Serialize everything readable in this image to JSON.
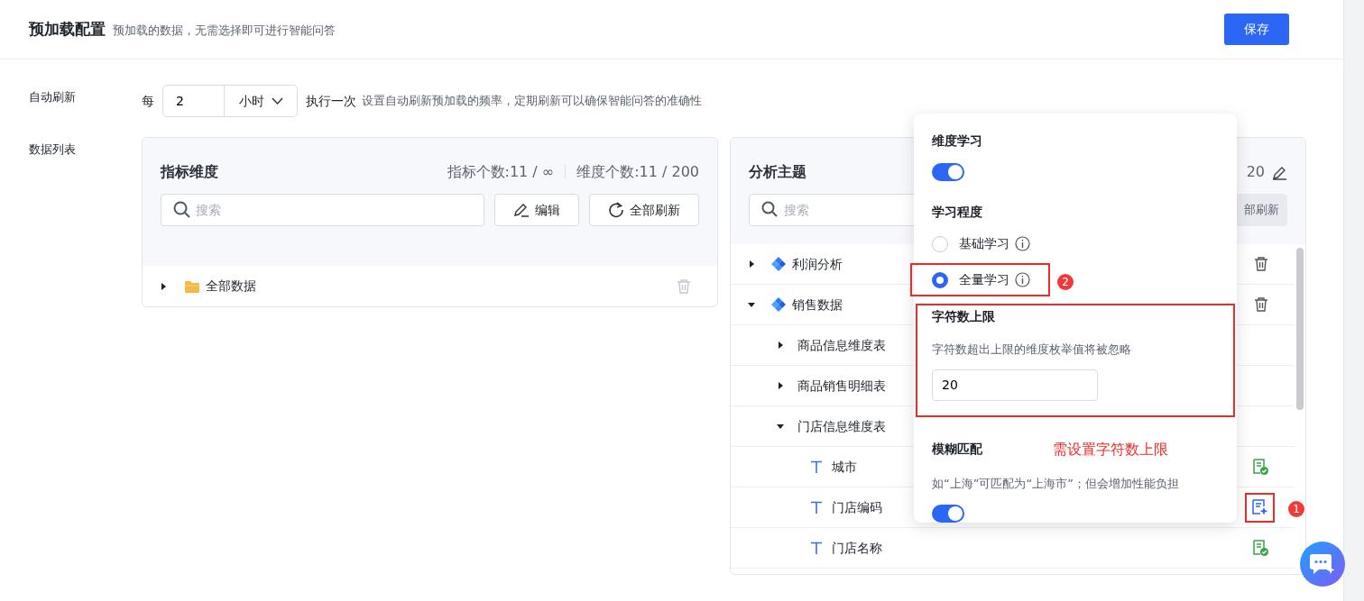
{
  "header": {
    "title": "预加载配置",
    "subtitle": "预加载的数据，无需选择即可进行智能问答",
    "save_button": "保存"
  },
  "auto_refresh": {
    "label": "自动刷新",
    "prefix": "每",
    "interval": "2",
    "unit": "小时",
    "suffix": "执行一次",
    "hint": "设置自动刷新预加载的频率，定期刷新可以确保智能问答的准确性"
  },
  "data_list": {
    "label": "数据列表"
  },
  "metrics_panel": {
    "title": "指标维度",
    "stats": [
      "指标个数:11 / ∞",
      "维度个数:11 / 200"
    ],
    "search": {
      "placeholder": "搜索"
    },
    "buttons": [
      {
        "label": "编辑",
        "kind": "edit"
      },
      {
        "label": "全部刷新",
        "kind": "refresh"
      }
    ],
    "tree": [
      {
        "label": "全部数据",
        "kind": "folder",
        "expanded": false
      }
    ]
  },
  "topics_panel": {
    "title": "分析主题",
    "stats": "20",
    "search": {
      "placeholder": "搜索"
    },
    "button": "部刷新",
    "tree": [
      {
        "label": "利润分析",
        "kind": "topic",
        "expanded": false
      },
      {
        "label": "销售数据",
        "kind": "topic",
        "expanded": true,
        "children": [
          {
            "label": "商品信息维度表",
            "kind": "table",
            "expanded": false
          },
          {
            "label": "商品销售明细表",
            "kind": "table",
            "expanded": false
          },
          {
            "label": "门店信息维度表",
            "kind": "table",
            "expanded": true,
            "children": [
              {
                "label": "城市",
                "kind": "field",
                "learned": true,
                "highlighted": false
              },
              {
                "label": "门店编码",
                "kind": "field",
                "learned": false,
                "highlighted": true,
                "badge": "1"
              },
              {
                "label": "门店名称",
                "kind": "field",
                "learned": true,
                "highlighted": false
              }
            ]
          }
        ]
      }
    ]
  },
  "popover": {
    "sections": [
      {
        "kind": "switch",
        "title": "维度学习",
        "on": true
      },
      {
        "kind": "radio",
        "title": "学习程度",
        "options": [
          {
            "label": "基础学习",
            "selected": false,
            "highlighted": false
          },
          {
            "label": "全量学习",
            "selected": true,
            "highlighted": true,
            "badge": "2"
          }
        ]
      },
      {
        "kind": "number",
        "title": "字符数上限",
        "hint": "字符数超出上限的维度枚举值将被忽略",
        "value": "20",
        "highlighted": true
      },
      {
        "kind": "switch",
        "title": "模糊匹配",
        "note": "需设置字符数上限",
        "hint": "如“上海”可匹配为“上海市”；但会增加性能负担",
        "on": true
      }
    ]
  }
}
